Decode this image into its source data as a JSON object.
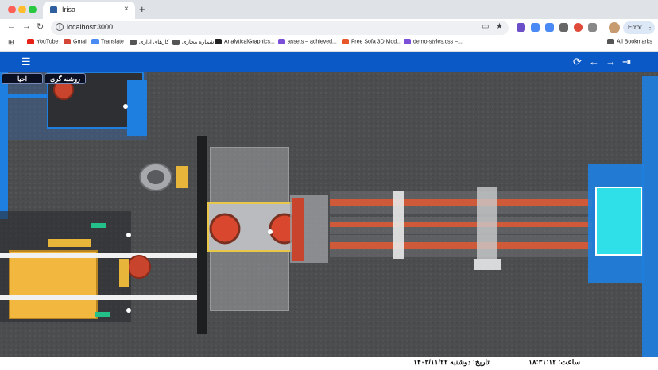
{
  "browser": {
    "tab_title": "Irisa",
    "tab_close": "×",
    "new_tab": "+",
    "url": "localhost:3000",
    "error_label": "Error",
    "error_menu": "⋮",
    "back": "←",
    "forward": "→",
    "reload": "↻",
    "grid": "⊞",
    "bookmarks": [
      {
        "label": "YouTube",
        "color": "#e62117"
      },
      {
        "label": "Gmail",
        "color": "#d44638"
      },
      {
        "label": "Translate",
        "color": "#4a8af4"
      },
      {
        "label": "کارهای اداری",
        "color": "#555555"
      },
      {
        "label": "شماره مجازی",
        "color": "#555555"
      },
      {
        "label": "AnalyticalGraphics...",
        "color": "#222222"
      },
      {
        "label": "assets – achieved...",
        "color": "#7b4fd8"
      },
      {
        "label": "Free Sofa 3D Mod...",
        "color": "#e8572a"
      },
      {
        "label": "demo-styles.css –...",
        "color": "#7b4fd8"
      }
    ],
    "all_bookmarks": "All Bookmarks",
    "accent": "#0b59c7"
  },
  "app": {
    "menu_glyph": "☰",
    "refresh_glyph": "⟳",
    "back_glyph": "←",
    "forward_glyph": "→",
    "exit_glyph": "⇥",
    "buttons": {
      "revive": "احیا",
      "lighting": "روشنه گری"
    },
    "status": {
      "time": "ساعت: ۱۸:۳۱:۱۲",
      "date": "تاریخ: دوشنبه ۱۴۰۳/۱۱/۲۲"
    }
  }
}
